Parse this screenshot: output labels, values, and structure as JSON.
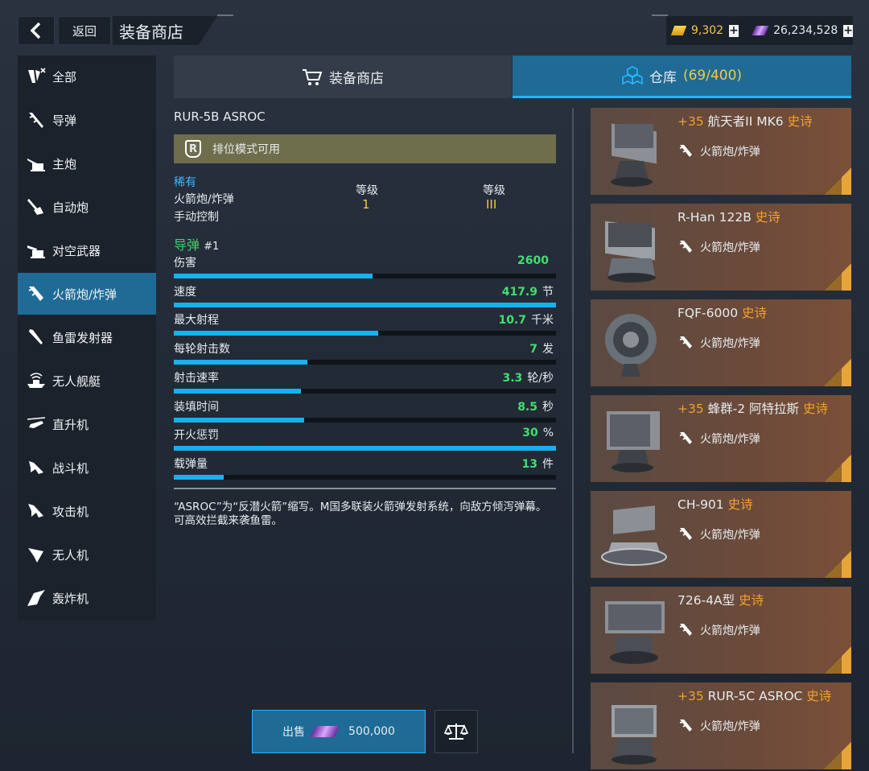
{
  "header": {
    "back_label": "返回",
    "title": "装备商店",
    "gold": "9,302",
    "crystals": "26,234,528"
  },
  "sidebar": {
    "items": [
      {
        "label": "全部",
        "icon": "all-icon"
      },
      {
        "label": "导弹",
        "icon": "missile-icon"
      },
      {
        "label": "主炮",
        "icon": "main-gun-icon"
      },
      {
        "label": "自动炮",
        "icon": "autocannon-icon"
      },
      {
        "label": "对空武器",
        "icon": "anti-air-icon"
      },
      {
        "label": "火箭炮/炸弹",
        "icon": "rocket-icon"
      },
      {
        "label": "鱼雷发射器",
        "icon": "torpedo-icon"
      },
      {
        "label": "无人舰艇",
        "icon": "drone-boat-icon"
      },
      {
        "label": "直升机",
        "icon": "helicopter-icon"
      },
      {
        "label": "战斗机",
        "icon": "fighter-icon"
      },
      {
        "label": "攻击机",
        "icon": "attack-plane-icon"
      },
      {
        "label": "无人机",
        "icon": "uav-icon"
      },
      {
        "label": "轰炸机",
        "icon": "bomber-icon"
      }
    ],
    "active": "火箭炮/炸弹"
  },
  "tabs": {
    "shop": "装备商店",
    "warehouse": "仓库",
    "warehouse_count": "(69/400)"
  },
  "detail": {
    "name": "RUR-5B ASROC",
    "rank_text": "排位模式可用",
    "rarity": "稀有",
    "type": "火箭炮/炸弹",
    "control": "手动控制",
    "level_header_1": "等级",
    "level_value_1": "1",
    "level_header_2": "等级",
    "level_value_2": "III",
    "missile_label": "导弹",
    "missile_num": "#1",
    "stats": [
      {
        "label": "伤害",
        "value": "2600",
        "unit": "",
        "fill": 0.52
      },
      {
        "label": "速度",
        "value": "417.9",
        "unit": "节",
        "fill": 1.0
      },
      {
        "label": "最大射程",
        "value": "10.7",
        "unit": "千米",
        "fill": 0.535
      },
      {
        "label": "每轮射击数",
        "value": "7",
        "unit": "发",
        "fill": 0.35
      },
      {
        "label": "射击速率",
        "value": "3.3",
        "unit": "轮/秒",
        "fill": 0.333
      },
      {
        "label": "装填时间",
        "value": "8.5",
        "unit": "秒",
        "fill": 0.34
      },
      {
        "label": "开火惩罚",
        "value": "30",
        "unit": "%",
        "fill": 1.0
      },
      {
        "label": "载弹量",
        "value": "13",
        "unit": "件",
        "fill": 0.13
      }
    ],
    "description": "“ASROC”为“反潜火箭”缩写。M国多联装火箭弹发射系统，向敌方倾泻弹幕。可高效拦截来袭鱼雷。"
  },
  "sell": {
    "label": "出售",
    "price": "500,000"
  },
  "warehouse_items": [
    {
      "plus": "+35",
      "name": "航天者II MK6",
      "rarity": "史诗",
      "category": "火箭炮/炸弹"
    },
    {
      "plus": "",
      "name": "R-Han 122B",
      "rarity": "史诗",
      "category": "火箭炮/炸弹"
    },
    {
      "plus": "",
      "name": "FQF-6000",
      "rarity": "史诗",
      "category": "火箭炮/炸弹"
    },
    {
      "plus": "+35",
      "name": "蜂群-2 阿特拉斯",
      "rarity": "史诗",
      "category": "火箭炮/炸弹"
    },
    {
      "plus": "",
      "name": "CH-901",
      "rarity": "史诗",
      "category": "火箭炮/炸弹"
    },
    {
      "plus": "",
      "name": "726-4A型",
      "rarity": "史诗",
      "category": "火箭炮/炸弹"
    },
    {
      "plus": "+35",
      "name": "RUR-5C ASROC",
      "rarity": "史诗",
      "category": "火箭炮/炸弹"
    }
  ],
  "colors": {
    "accent": "#1f6b96",
    "highlight": "#20b6ff",
    "stat_value": "#3fe06e",
    "epic": "#f0a030",
    "rare": "#3fb6ff"
  }
}
